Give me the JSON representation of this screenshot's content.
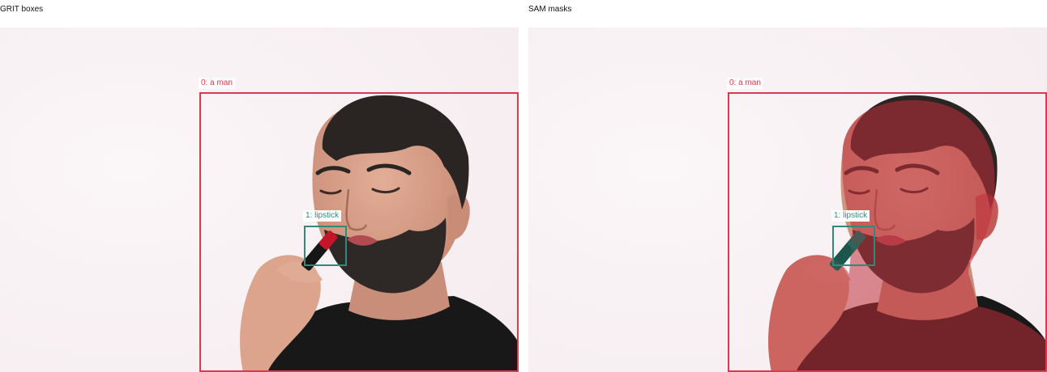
{
  "panels": [
    {
      "title": "GRIT boxes",
      "mask_overlay": false,
      "detections": [
        {
          "label": "0: a man",
          "color": "#d93a4e"
        },
        {
          "label": "1: lipstick",
          "color": "#2e8b7a"
        }
      ]
    },
    {
      "title": "SAM masks",
      "mask_overlay": true,
      "detections": [
        {
          "label": "0: a man",
          "color": "#d93a4e"
        },
        {
          "label": "1: lipstick",
          "color": "#2e8b7a"
        }
      ]
    }
  ],
  "colors": {
    "background": "#f8f1f4",
    "skin": "#d9a08a",
    "hair": "#2a2423",
    "shirt": "#181818",
    "lipstick": "#c4162a",
    "man_mask": "#c0303c",
    "lipstick_mask": "#1f6b5e"
  }
}
